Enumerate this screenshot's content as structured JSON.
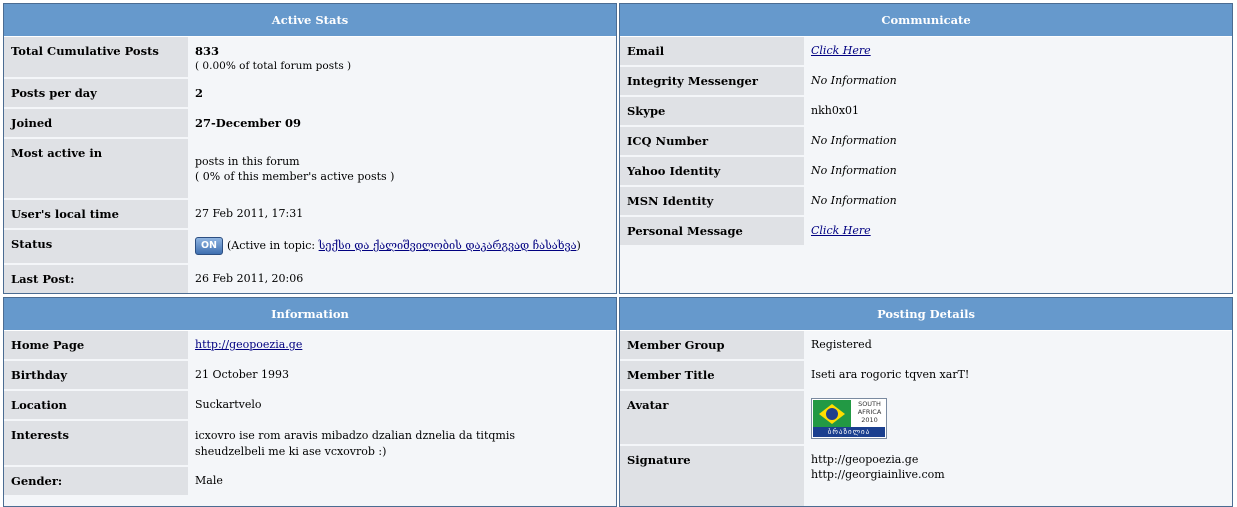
{
  "active_stats": {
    "title": "Active Stats",
    "total_posts_label": "Total Cumulative Posts",
    "total_posts_value": "833",
    "total_posts_note": "( 0.00% of total forum posts )",
    "posts_per_day_label": "Posts per day",
    "posts_per_day_value": "2",
    "joined_label": "Joined",
    "joined_value": "27-December 09",
    "most_active_label": "Most active in",
    "most_active_line1": "posts in this forum",
    "most_active_line2": "( 0% of this member's active posts )",
    "local_time_label": "User's local time",
    "local_time_value": "27 Feb 2011, 17:31",
    "status_label": "Status",
    "status_badge": "ON",
    "status_prefix": "(Active in topic: ",
    "status_topic": "სექსი და ქალიშვილობის დაკარგვად ჩასახვა",
    "status_suffix": ")",
    "last_post_label": "Last Post:",
    "last_post_value": "26 Feb 2011, 20:06"
  },
  "communicate": {
    "title": "Communicate",
    "email_label": "Email",
    "email_value": "Click Here",
    "integrity_label": "Integrity Messenger",
    "integrity_value": "No Information",
    "skype_label": "Skype",
    "skype_value": "nkh0x01",
    "icq_label": "ICQ Number",
    "icq_value": "No Information",
    "yahoo_label": "Yahoo Identity",
    "yahoo_value": "No Information",
    "msn_label": "MSN Identity",
    "msn_value": "No Information",
    "pm_label": "Personal Message",
    "pm_value": "Click Here"
  },
  "information": {
    "title": "Information",
    "homepage_label": "Home Page",
    "homepage_value": "http://geopoezia.ge",
    "birthday_label": "Birthday",
    "birthday_value": "21 October 1993",
    "location_label": "Location",
    "location_value": "Suckartvelo",
    "interests_label": "Interests",
    "interests_value": "icxovro ise rom aravis mibadzo dzalian dznelia da titqmis sheudzelbeli me ki ase vcxovrob :)",
    "gender_label": "Gender:",
    "gender_value": "Male"
  },
  "posting_details": {
    "title": "Posting Details",
    "group_label": "Member Group",
    "group_value": "Registered",
    "member_title_label": "Member Title",
    "member_title_value": "Iseti ara rogoric tqven xarT!",
    "avatar_label": "Avatar",
    "avatar_text_top": "SOUTH AFRICA 2010",
    "avatar_text_bottom": "ბრაზილია",
    "signature_label": "Signature",
    "signature_line1": "http://geopoezia.ge",
    "signature_line2": "http://georgiainlive.com"
  }
}
